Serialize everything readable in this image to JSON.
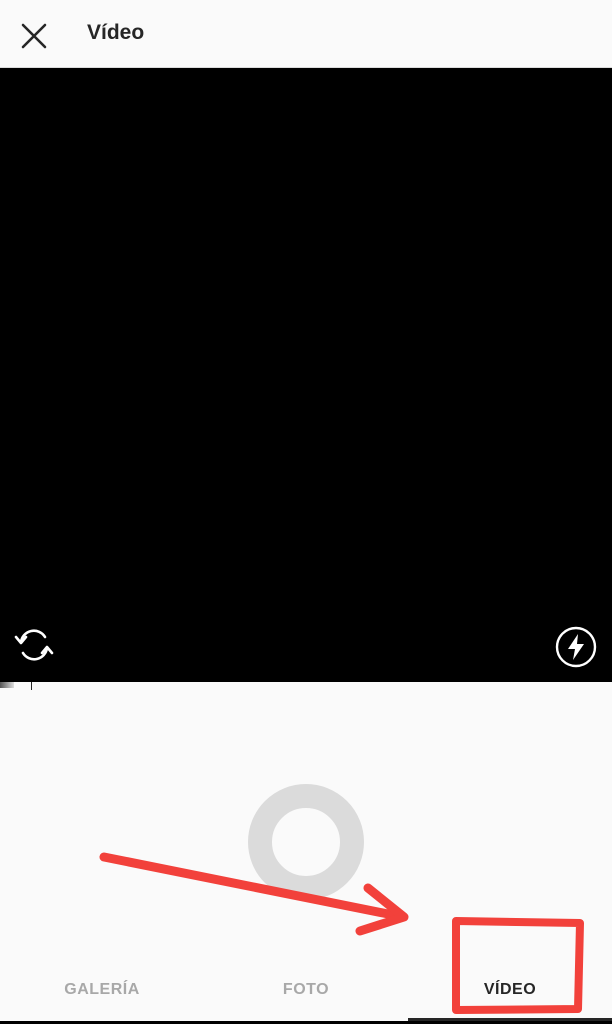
{
  "header": {
    "title": "Vídeo",
    "close_icon": "close-icon"
  },
  "camera": {
    "switch_icon": "switch-camera-icon",
    "flash_icon": "flash-icon"
  },
  "capture": {
    "shutter_icon": "record-button"
  },
  "tabs": [
    {
      "label": "GALERÍA",
      "active": false
    },
    {
      "label": "FOTO",
      "active": false
    },
    {
      "label": "VÍDEO",
      "active": true
    }
  ],
  "colors": {
    "annotation": "#f2413b",
    "active_tab": "#262626",
    "inactive_tab": "#a8a8a8",
    "shutter_ring": "#dbdbdb"
  }
}
